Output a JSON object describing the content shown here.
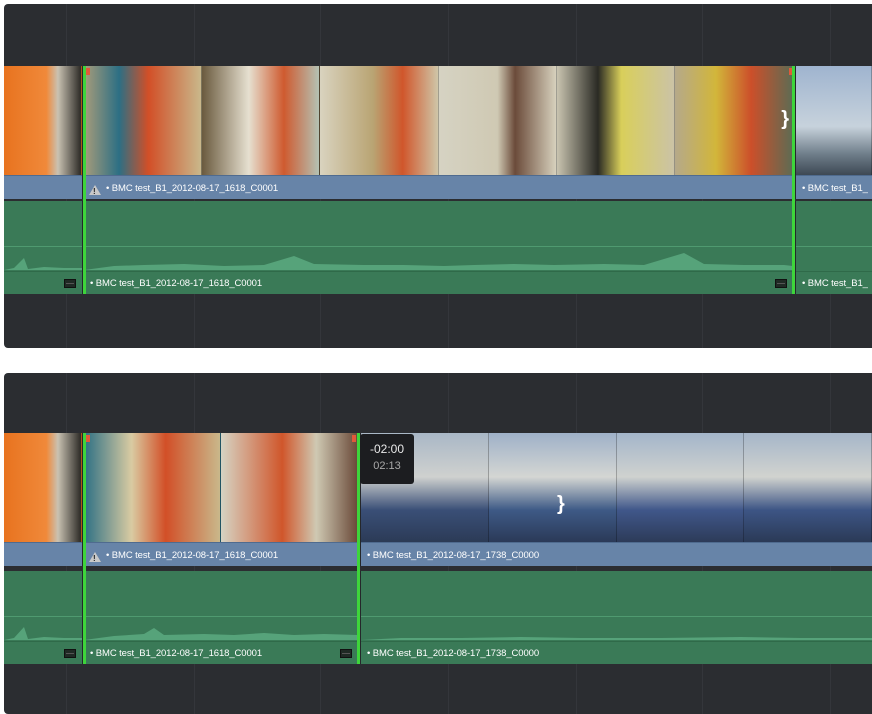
{
  "panels": [
    {
      "clips": {
        "video_main": "• BMC test_B1_2012-08-17_1618_C0001",
        "video_next": "• BMC test_B1_",
        "audio_main": "• BMC test_B1_2012-08-17_1618_C0001",
        "audio_next": "• BMC test_B1_"
      }
    },
    {
      "clips": {
        "video_main": "• BMC test_B1_2012-08-17_1618_C0001",
        "video_next": "• BMC test_B1_2012-08-17_1738_C0000",
        "audio_main": "• BMC test_B1_2012-08-17_1618_C0001",
        "audio_next": "• BMC test_B1_2012-08-17_1738_C0000"
      },
      "tooltip": {
        "offset": "-02:00",
        "duration": "02:13"
      }
    }
  ],
  "icons": {
    "warning": "warning-icon",
    "trim_bracket": "}",
    "mute": "audio-mute-icon"
  },
  "colors": {
    "video_clip": "#6784a8",
    "audio_clip": "#3a7a57",
    "selection": "#3ed53b",
    "panel_bg": "#2b2d31"
  }
}
